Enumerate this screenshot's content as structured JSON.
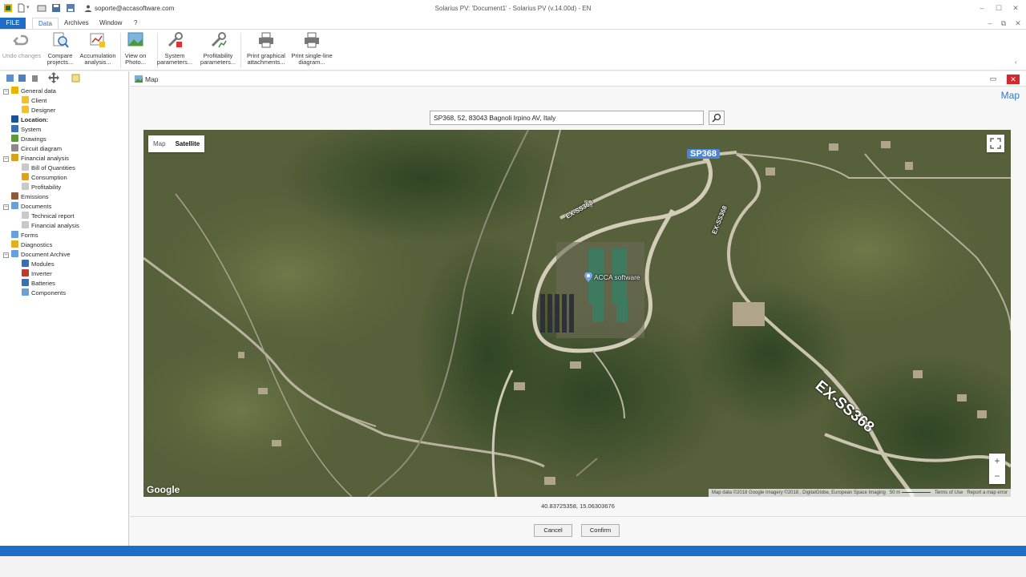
{
  "titlebar": {
    "account": "soporte@accasoftware.com",
    "app_title": "Solarius PV: 'Document1' - Solarius PV (v.14.00d) - EN"
  },
  "ribbon": {
    "tabs": [
      "FILE",
      "Data",
      "Archives",
      "Window",
      "?"
    ],
    "active_tab": "Data",
    "buttons": [
      {
        "label1": "Undo changes",
        "label2": ""
      },
      {
        "label1": "Compare",
        "label2": "projects..."
      },
      {
        "label1": "Accumulation",
        "label2": "analysis..."
      },
      {
        "label1": "View on",
        "label2": "Photo..."
      },
      {
        "label1": "System",
        "label2": "parameters..."
      },
      {
        "label1": "Profitability",
        "label2": "parameters..."
      },
      {
        "label1": "Print graphical",
        "label2": "attachments..."
      },
      {
        "label1": "Print single-line",
        "label2": "diagram..."
      }
    ]
  },
  "tree": {
    "items": [
      {
        "label": "General data"
      },
      {
        "label": "Client"
      },
      {
        "label": "Designer"
      },
      {
        "label": "Location:"
      },
      {
        "label": "System"
      },
      {
        "label": "Drawings"
      },
      {
        "label": "Circuit diagram"
      },
      {
        "label": "Financial analysis"
      },
      {
        "label": "Bill of Quantities"
      },
      {
        "label": "Consumption"
      },
      {
        "label": "Profitability"
      },
      {
        "label": "Emissions"
      },
      {
        "label": "Documents"
      },
      {
        "label": "Technical report"
      },
      {
        "label": "Financial analysis"
      },
      {
        "label": "Forms"
      },
      {
        "label": "Diagnostics"
      },
      {
        "label": "Document Archive"
      },
      {
        "label": "Modules"
      },
      {
        "label": "Inverter"
      },
      {
        "label": "Batteries"
      },
      {
        "label": "Components"
      }
    ]
  },
  "map_window": {
    "title": "Map",
    "header": "Map",
    "search_value": "SP368, 52, 83043 Bagnoli Irpino AV, Italy",
    "map_types": [
      "Map",
      "Satellite"
    ],
    "selected_map_type": "Satellite",
    "marker_label": "ACCA software",
    "road_labels": {
      "sp368_badge": "SP368",
      "exss_small_1": "EX-SS368",
      "exss_small_2": "EX-SS368",
      "exss_big": "EX-SS368"
    },
    "google": "Google",
    "attribution": "Map data ©2018 Google Imagery ©2018 , DigitalGlobe, European Space Imaging",
    "scale": "50 m",
    "terms": "Terms of Use",
    "report": "Report a map error",
    "zoom_in": "+",
    "zoom_out": "−",
    "coordinates": "40.83725358, 15.06303676",
    "cancel_label": "Cancel",
    "confirm_label": "Confirm"
  },
  "colors": {
    "accent": "#1e6ec8",
    "close": "#d9262a",
    "header": "#2a7bd0"
  }
}
